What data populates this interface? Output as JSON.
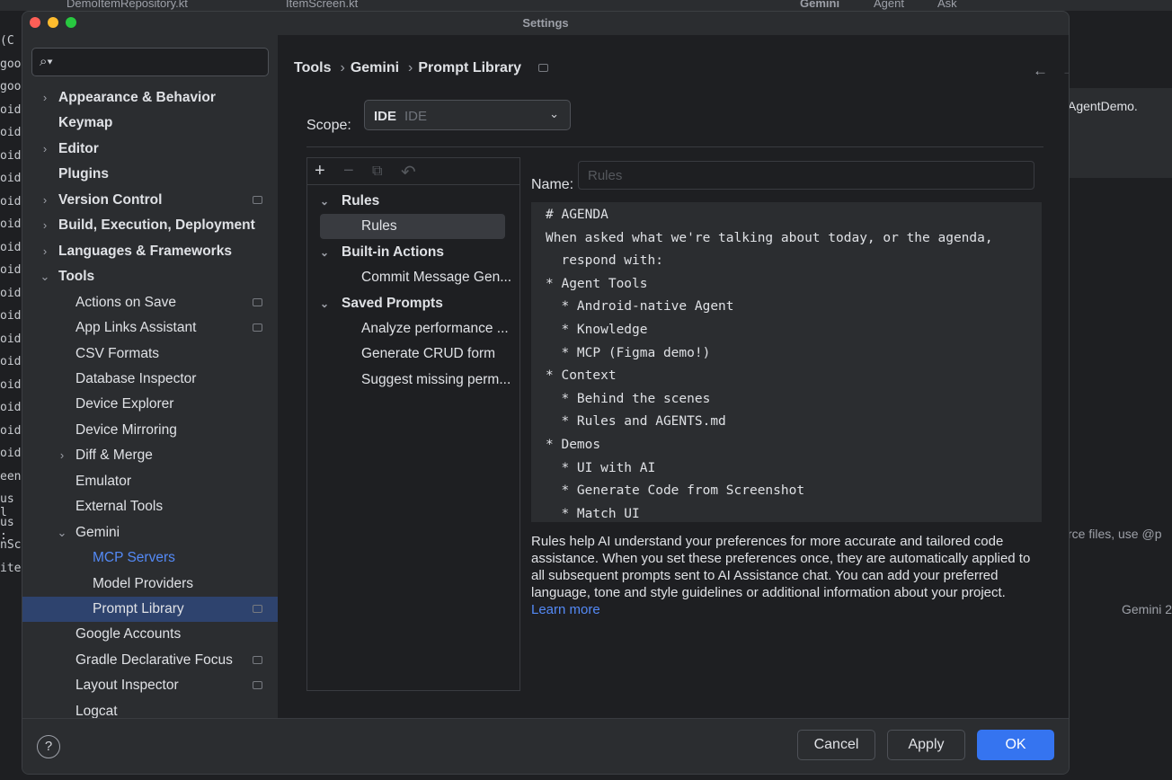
{
  "background_ide": {
    "tabs": [
      "DemoItemRepository.kt",
      "ItemScreen.kt",
      "Gemini",
      "Agent",
      "Ask"
    ],
    "left_code_fragments": [
      "(C",
      "goo",
      "goo",
      "oid:",
      "oid:",
      "oid:",
      "oid:",
      "oid:",
      "oid:",
      "oid:",
      "oid:",
      "oid:",
      "oid:",
      "oid:",
      "oid:",
      "oid:",
      "oid:",
      "oid:",
      "oid:",
      "een",
      "us l",
      "us :",
      "nScr",
      "items"
    ],
    "right_text_1": "AgentDemo.",
    "right_text_2": "rce files, use @p",
    "right_text_3": "Gemini 2"
  },
  "dialog": {
    "title": "Settings",
    "traffic_lights": {
      "close": "#ff5f57",
      "minimize": "#febc2e",
      "maximize": "#28c840"
    },
    "search": {
      "icon": "search-icon",
      "placeholder": ""
    },
    "tree": [
      {
        "label": "Appearance & Behavior",
        "level": 0,
        "expandable": true,
        "expanded": false,
        "bold": true
      },
      {
        "label": "Keymap",
        "level": 0,
        "expandable": false,
        "bold": true
      },
      {
        "label": "Editor",
        "level": 0,
        "expandable": true,
        "expanded": false,
        "bold": true
      },
      {
        "label": "Plugins",
        "level": 0,
        "expandable": false,
        "bold": true
      },
      {
        "label": "Version Control",
        "level": 0,
        "expandable": true,
        "expanded": false,
        "bold": true,
        "pin": true
      },
      {
        "label": "Build, Execution, Deployment",
        "level": 0,
        "expandable": true,
        "expanded": false,
        "bold": true
      },
      {
        "label": "Languages & Frameworks",
        "level": 0,
        "expandable": true,
        "expanded": false,
        "bold": true
      },
      {
        "label": "Tools",
        "level": 0,
        "expandable": true,
        "expanded": true,
        "bold": true
      },
      {
        "label": "Actions on Save",
        "level": 1,
        "pin": true
      },
      {
        "label": "App Links Assistant",
        "level": 1,
        "pin": true
      },
      {
        "label": "CSV Formats",
        "level": 1
      },
      {
        "label": "Database Inspector",
        "level": 1
      },
      {
        "label": "Device Explorer",
        "level": 1
      },
      {
        "label": "Device Mirroring",
        "level": 1
      },
      {
        "label": "Diff & Merge",
        "level": 1,
        "expandable": true,
        "expanded": false
      },
      {
        "label": "Emulator",
        "level": 1
      },
      {
        "label": "External Tools",
        "level": 1
      },
      {
        "label": "Gemini",
        "level": 1,
        "expandable": true,
        "expanded": true
      },
      {
        "label": "MCP Servers",
        "level": 2,
        "link": true
      },
      {
        "label": "Model Providers",
        "level": 2
      },
      {
        "label": "Prompt Library",
        "level": 2,
        "selected": true,
        "pin": true
      },
      {
        "label": "Google Accounts",
        "level": 1
      },
      {
        "label": "Gradle Declarative Focus",
        "level": 1,
        "pin": true
      },
      {
        "label": "Layout Inspector",
        "level": 1,
        "pin": true
      },
      {
        "label": "Logcat",
        "level": 1
      }
    ],
    "breadcrumb": [
      "Tools",
      "Gemini",
      "Prompt Library"
    ],
    "scope": {
      "label": "Scope:",
      "value": "IDE",
      "hint": "IDE"
    },
    "library_toolbar": [
      "+",
      "−",
      "⧉",
      "↶"
    ],
    "library": [
      {
        "label": "Rules",
        "type": "group"
      },
      {
        "label": "Rules",
        "type": "item",
        "selected": true
      },
      {
        "label": "Built-in Actions",
        "type": "group"
      },
      {
        "label": "Commit Message Gen...",
        "type": "item"
      },
      {
        "label": "Saved Prompts",
        "type": "group"
      },
      {
        "label": "Analyze performance ...",
        "type": "item"
      },
      {
        "label": "Generate CRUD form",
        "type": "item"
      },
      {
        "label": "Suggest missing perm...",
        "type": "item"
      }
    ],
    "name_field": {
      "label": "Name:",
      "placeholder": "Rules"
    },
    "editor_lines": [
      "# AGENDA",
      "When asked what we're talking about today, or the agenda,",
      "  respond with:",
      "* Agent Tools",
      "  * Android-native Agent",
      "  * Knowledge",
      "  * MCP (Figma demo!)",
      "* Context",
      "  * Behind the scenes",
      "  * Rules and AGENTS.md",
      "* Demos",
      "  * UI with AI",
      "  * Generate Code from Screenshot",
      "  * Match UI"
    ],
    "help_text": "Rules help AI understand your preferences for more accurate and tailored code assistance. When you set these preferences once, they are automatically applied to all subsequent prompts sent to AI Assistance chat. You can add your preferred language, tone and style guidelines or additional information about your project.",
    "help_link": "Learn more",
    "buttons": {
      "cancel": "Cancel",
      "apply": "Apply",
      "ok": "OK",
      "help": "?"
    }
  }
}
